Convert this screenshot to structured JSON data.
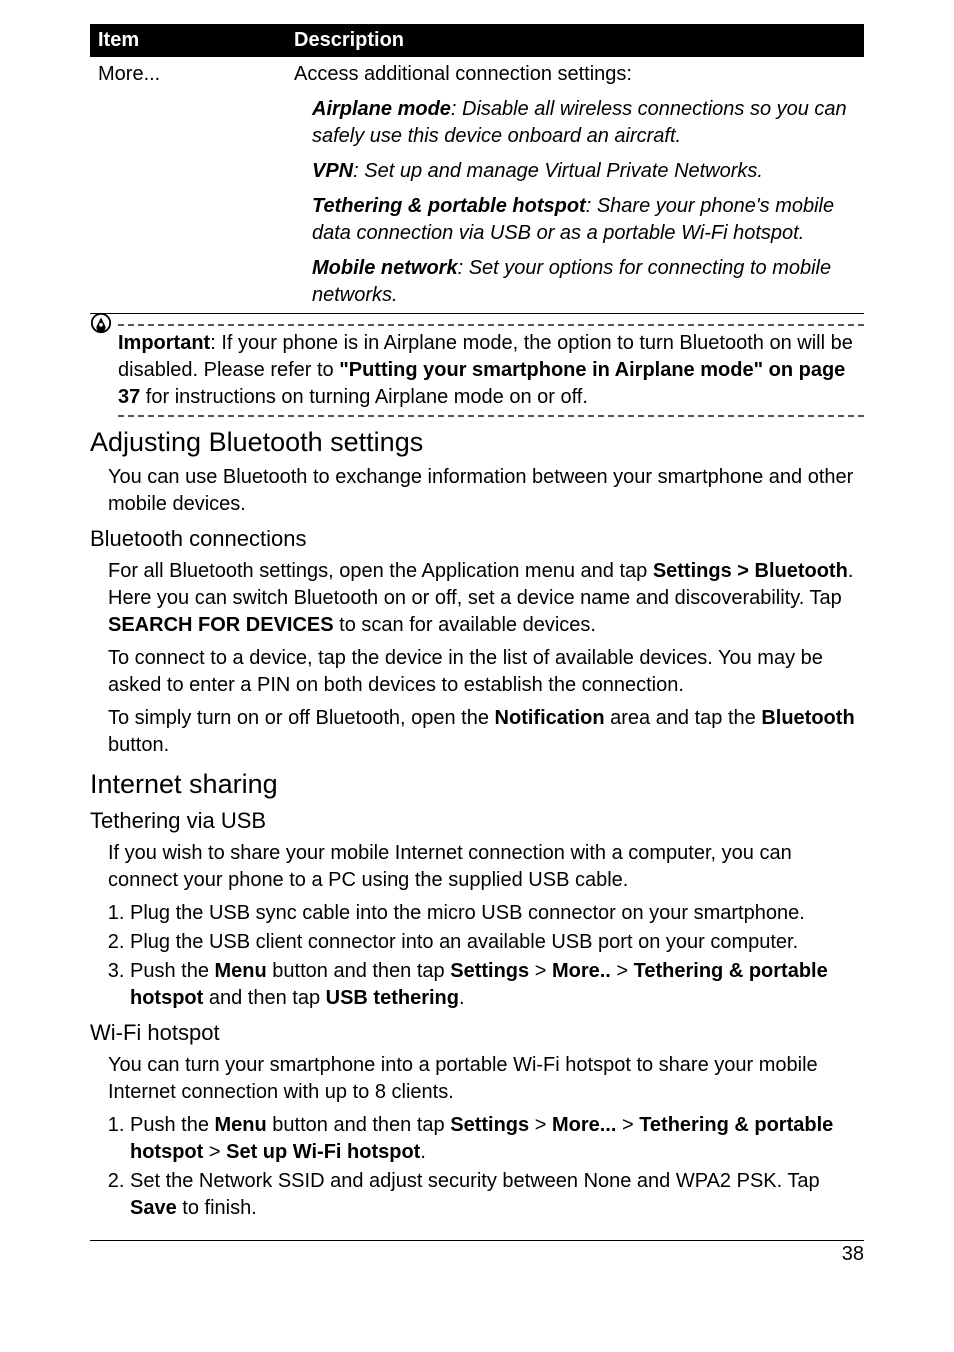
{
  "table": {
    "headers": {
      "item": "Item",
      "desc": "Description"
    },
    "item_label": "More...",
    "desc_intro": "Access additional connection settings:",
    "subs": [
      {
        "lead": "Airplane mode",
        "rest": ": Disable all wireless connections so you can safely use this device onboard an aircraft."
      },
      {
        "lead": "VPN",
        "rest": ": Set up and manage Virtual Private Networks."
      },
      {
        "lead": "Tethering & portable hotspot",
        "rest": ": Share your phone's mobile data connection via USB or as a portable Wi-Fi hotspot."
      },
      {
        "lead": "Mobile network",
        "rest": ": Set your options for connecting to mobile networks."
      }
    ]
  },
  "note": {
    "lead": "Important",
    "part1": ": If your phone is in Airplane mode, the option to turn Bluetooth on will be disabled. Please refer to ",
    "bold_ref": "\"Putting your smartphone in Airplane mode\" on page 37",
    "part2": " for instructions on turning Airplane mode on or off."
  },
  "bt": {
    "heading": "Adjusting Bluetooth settings",
    "intro": "You can use Bluetooth to exchange information between your smartphone and other mobile devices.",
    "conn_heading": "Bluetooth connections",
    "p1_a": "For all Bluetooth settings, open the Application menu and tap ",
    "p1_b": "Settings > Bluetooth",
    "p1_c": ". Here you can switch Bluetooth on or off, set a device name and discoverability. Tap ",
    "p1_d": "SEARCH FOR DEVICES",
    "p1_e": " to scan for available devices.",
    "p2": "To connect to a device, tap the device in the list of available devices. You may be asked to enter a PIN on both devices to establish the connection.",
    "p3_a": "To simply turn on or off Bluetooth, open the ",
    "p3_b": "Notification",
    "p3_c": " area and tap the ",
    "p3_d": "Bluetooth",
    "p3_e": " button."
  },
  "net": {
    "heading": "Internet sharing",
    "usb_heading": "Tethering via USB",
    "usb_intro": "If you wish to share your mobile Internet connection with a computer, you can connect your phone to a PC using the supplied USB cable.",
    "usb_steps": {
      "s1": "Plug the USB sync cable into the micro USB connector on your smartphone.",
      "s2": "Plug the USB client connector into an available USB port on your computer.",
      "s3_a": "Push the ",
      "s3_b": "Menu",
      "s3_c": " button and then tap ",
      "s3_d": "Settings",
      "s3_e": " > ",
      "s3_f": "More..",
      "s3_g": " > ",
      "s3_h": "Tethering & portable hotspot",
      "s3_i": " and then tap ",
      "s3_j": "USB tethering",
      "s3_k": "."
    },
    "wifi_heading": "Wi-Fi hotspot",
    "wifi_intro": "You can turn your smartphone into a portable Wi-Fi hotspot to share your mobile Internet connection with up to 8 clients.",
    "wifi_steps": {
      "s1_a": "Push the ",
      "s1_b": "Menu",
      "s1_c": " button and then tap ",
      "s1_d": "Settings",
      "s1_e": " > ",
      "s1_f": "More...",
      "s1_g": " > ",
      "s1_h": "Tethering & portable hotspot",
      "s1_i": " > ",
      "s1_j": "Set up Wi-Fi hotspot",
      "s1_k": ".",
      "s2_a": "Set the Network SSID and adjust security between None and WPA2 PSK. Tap ",
      "s2_b": "Save",
      "s2_c": " to finish."
    }
  },
  "page_number": "38"
}
